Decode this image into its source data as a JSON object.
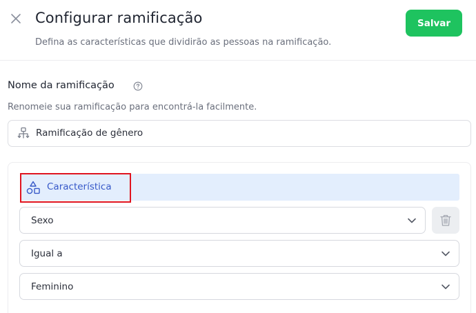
{
  "header": {
    "title": "Configurar ramificação",
    "subtitle": "Defina as características que dividirão as pessoas na ramificação.",
    "save_label": "Salvar"
  },
  "name_section": {
    "label": "Nome da ramificação",
    "description": "Renomeie sua ramificação para encontrá-la facilmente.",
    "input_value": "Ramificação de gênero"
  },
  "rule": {
    "header_label": "Característica",
    "attribute_value": "Sexo",
    "operator_value": "Igual a",
    "target_value": "Feminino"
  },
  "colors": {
    "save_button": "#1ec35f",
    "characteristic_header_bg": "#e3eefd",
    "characteristic_text": "#3658c8",
    "highlight_outline": "#e0141f"
  },
  "icons": {
    "close": "close-icon",
    "help": "help-circle-icon",
    "branch": "branch-icon",
    "characteristic": "shapes-icon",
    "chevron": "chevron-down-icon",
    "delete": "trash-icon"
  }
}
